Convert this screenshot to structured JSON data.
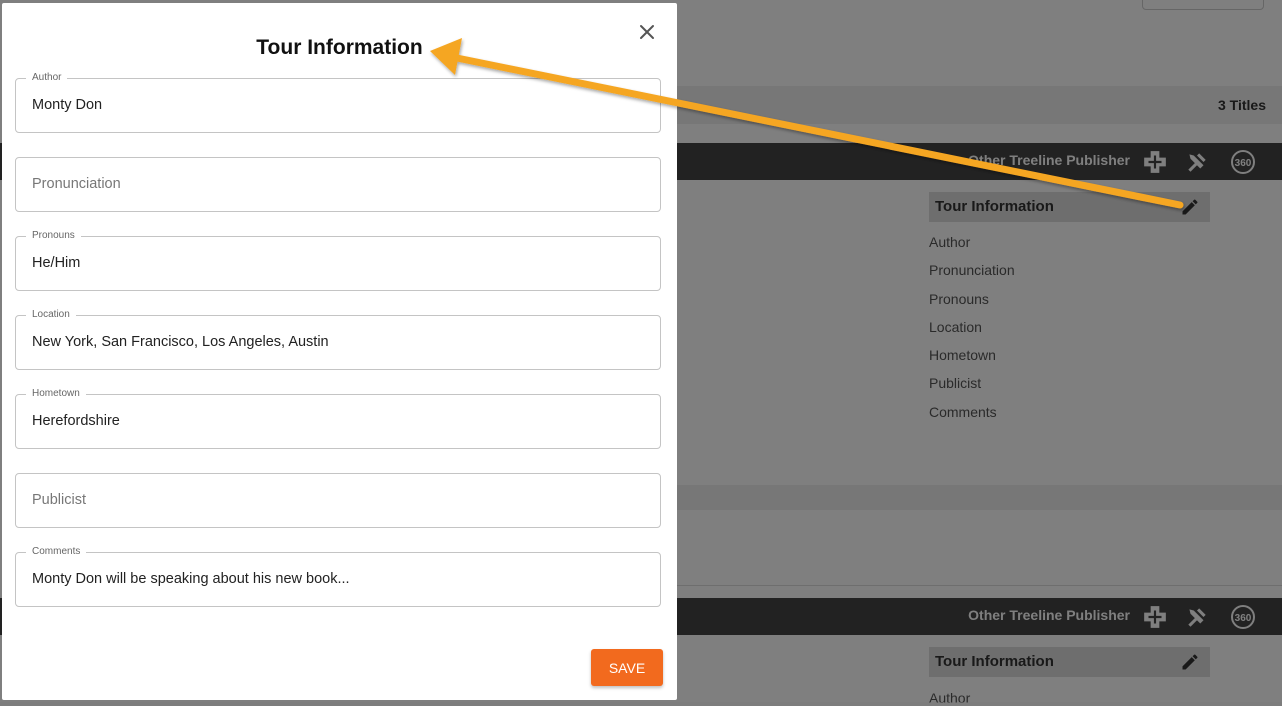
{
  "background": {
    "titles_count": "3 Titles",
    "publisher_name_1": "Other Treeline Publisher",
    "publisher_name_2": "Other Treeline Publisher",
    "tour_info_title_1": "Tour Information",
    "tour_info_title_2": "Tour Information",
    "tour_info_fields": [
      "Author",
      "Pronunciation",
      "Pronouns",
      "Location",
      "Hometown",
      "Publicist",
      "Comments"
    ],
    "tour_info_field_first_2": "Author",
    "icons": [
      "add-icon",
      "tools-icon",
      "360-icon",
      "pencil-icon"
    ]
  },
  "modal": {
    "title": "Tour Information",
    "close_icon": "close-icon",
    "fields": [
      {
        "label": "Author",
        "value": "Monty Don",
        "placeholder": ""
      },
      {
        "label": "",
        "value": "",
        "placeholder": "Pronunciation"
      },
      {
        "label": "Pronouns",
        "value": "He/Him",
        "placeholder": ""
      },
      {
        "label": "Location",
        "value": "New York, San Francisco, Los Angeles, Austin",
        "placeholder": ""
      },
      {
        "label": "Hometown",
        "value": "Herefordshire",
        "placeholder": ""
      },
      {
        "label": "",
        "value": "",
        "placeholder": "Publicist"
      },
      {
        "label": "Comments",
        "value": "Monty Don will be speaking about his new book...",
        "placeholder": ""
      }
    ],
    "save_label": "SAVE"
  },
  "colors": {
    "accent": "#f26a1e",
    "annotation_arrow": "#f5a623",
    "dark_bar": "#444444"
  }
}
